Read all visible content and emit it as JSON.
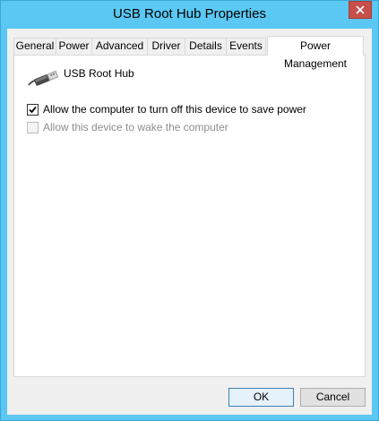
{
  "window": {
    "title": "USB Root Hub Properties",
    "close_icon": "close-icon"
  },
  "tabs": [
    {
      "label": "General"
    },
    {
      "label": "Power"
    },
    {
      "label": "Advanced"
    },
    {
      "label": "Driver"
    },
    {
      "label": "Details"
    },
    {
      "label": "Events"
    },
    {
      "label": "Power Management",
      "active": true
    }
  ],
  "panel": {
    "device_icon": "usb-plug-icon",
    "device_name": "USB Root Hub",
    "options": [
      {
        "label": "Allow the computer to turn off this device to save power",
        "checked": true,
        "enabled": true
      },
      {
        "label": "Allow this device to wake the computer",
        "checked": false,
        "enabled": false
      }
    ]
  },
  "buttons": {
    "ok": "OK",
    "cancel": "Cancel"
  }
}
